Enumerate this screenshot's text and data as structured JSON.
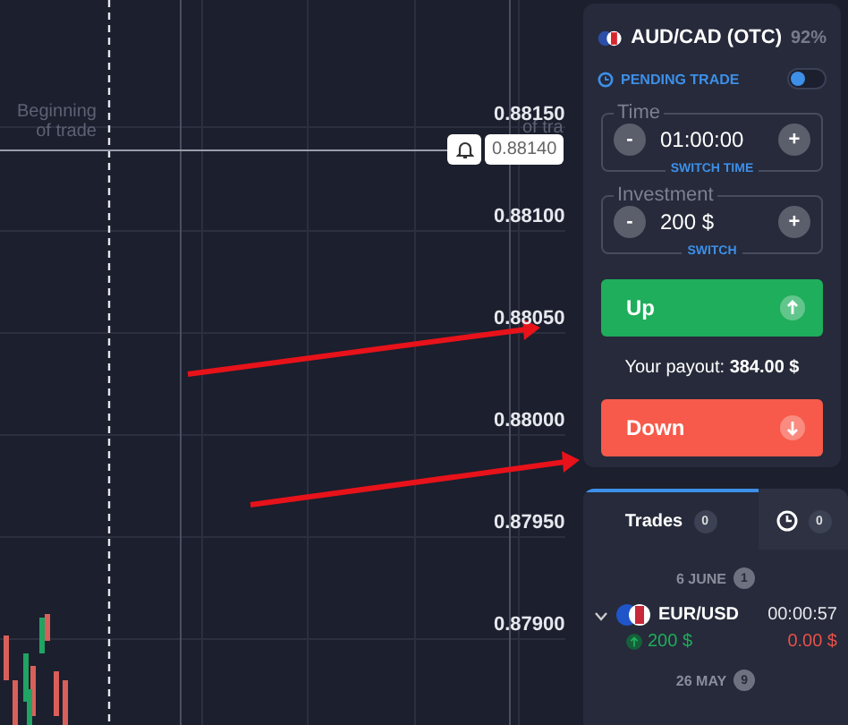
{
  "chart": {
    "start_label": "Beginning of trade",
    "end_label": "of tra",
    "current_price": "0.88140",
    "prices": [
      "0.88150",
      "0.88100",
      "0.88050",
      "0.88000",
      "0.87950",
      "0.87900"
    ]
  },
  "asset": {
    "name": "AUD/CAD (OTC)",
    "payout_percent": "92%"
  },
  "pending_trade": {
    "label": "PENDING TRADE",
    "on": false
  },
  "time": {
    "legend": "Time",
    "value": "01:00:00",
    "minus": "-",
    "plus": "+",
    "switch": "SWITCH TIME"
  },
  "investment": {
    "legend": "Investment",
    "value": "200 $",
    "minus": "-",
    "plus": "+",
    "switch": "SWITCH"
  },
  "up_button": "Up",
  "payout": "Your payout: **384.00 $**",
  "down_button": "Down",
  "trades_tabs": [
    {
      "label": "Trades",
      "count": "0",
      "selected": true
    },
    {
      "count": "0",
      "selected": false
    }
  ],
  "groups": [
    {
      "date": "6 JUNE",
      "count": "1",
      "trades": [
        {
          "pair": "EUR/USD",
          "time": "00:00:57",
          "amount": "200 $",
          "result": "0.00 $",
          "expanded": false
        }
      ]
    },
    {
      "date": "26 MAY",
      "count": "9"
    }
  ]
}
